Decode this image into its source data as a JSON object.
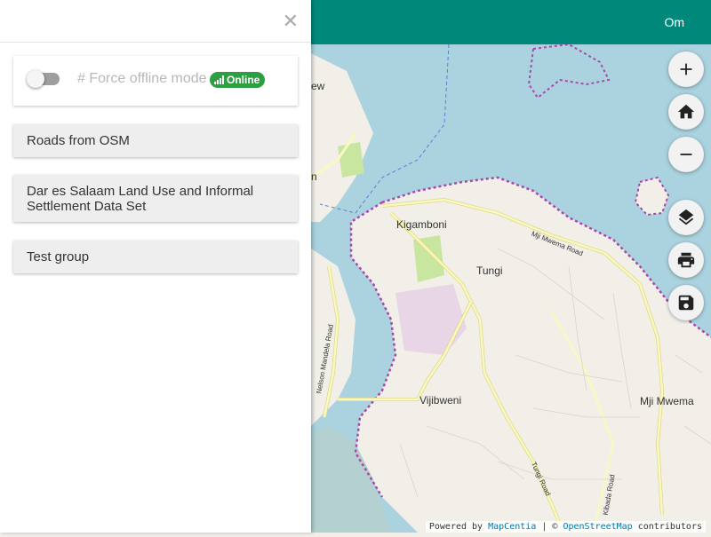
{
  "topbar": {
    "user_label": "Om"
  },
  "panel": {
    "close_glyph": "✕",
    "offline": {
      "label": "# Force offline mode",
      "status_badge": "Online",
      "status_color": "#2e9e42",
      "toggle_state": "off"
    },
    "layer_groups": [
      {
        "label": "Roads from OSM"
      },
      {
        "label": "Dar es Salaam Land Use and Informal Settlement Data Set"
      },
      {
        "label": "Test group"
      }
    ]
  },
  "map": {
    "labels": {
      "kigamboni": "Kigamboni",
      "tungi": "Tungi",
      "vijibweni": "Vijibweni",
      "mji_mwema": "Mji Mwema",
      "mji_mwema_road": "Mji Mwema Road",
      "tungi_road": "Tungi Road",
      "kibada_road": "Kibada Road",
      "mandela_road": "Nelson Mandela Road",
      "edge_ew": "ew",
      "edge_n": "n"
    },
    "controls": {
      "zoom_in": "zoom-in",
      "home": "home",
      "zoom_out": "zoom-out",
      "layers": "layers",
      "print": "print",
      "save": "save"
    },
    "attribution": {
      "powered_by": "Powered by",
      "mapcentia": "MapCentia",
      "separator": "| ©",
      "osm": "OpenStreetMap",
      "contributors": "contributors"
    }
  },
  "colors": {
    "topbar": "#00897b",
    "water": "#aad3df",
    "land": "#f2efe9",
    "road": "#f7fabf",
    "boundary": "#ac46ac"
  }
}
